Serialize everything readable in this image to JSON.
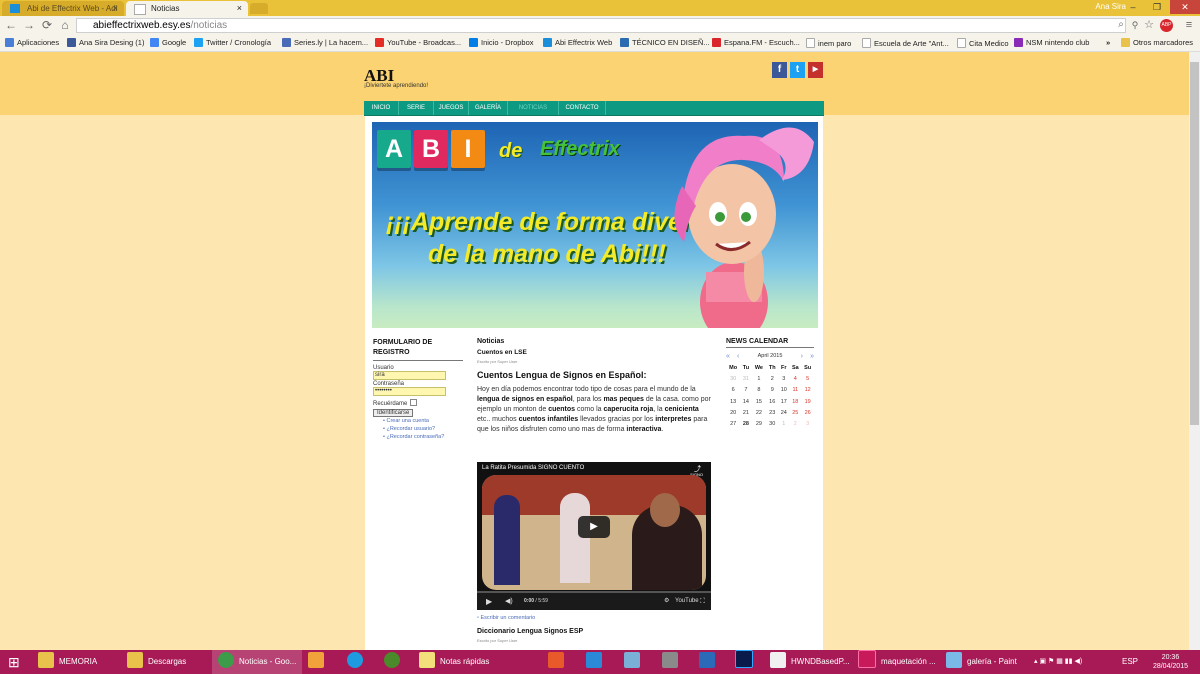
{
  "browser": {
    "tabs": [
      {
        "title": "Abi de Effectrix Web - Adi",
        "close": "×"
      },
      {
        "title": "Noticias",
        "close": "×"
      }
    ],
    "user": "Ana Sira",
    "window_controls": {
      "minimize": "–",
      "maximize": "❐",
      "close": "✕"
    },
    "nav": {
      "back": "←",
      "forward": "→",
      "reload": "⟳",
      "home": "⌂"
    },
    "url": {
      "domain": "abieffectrixweb.esy.es",
      "path": "/noticias"
    },
    "bookmarks": [
      {
        "label": "Aplicaciones",
        "color": "#4a7fd8"
      },
      {
        "label": "Ana Sira Desing (1)",
        "color": "#3b5998"
      },
      {
        "label": "Google",
        "color": "#4285f4"
      },
      {
        "label": "Twitter / Cronología",
        "color": "#1da1f2"
      },
      {
        "label": "Series.ly | La hacem...",
        "color": "#4a6bb8"
      },
      {
        "label": "YouTube - Broadcas...",
        "color": "#e52d27"
      },
      {
        "label": "Inicio - Dropbox",
        "color": "#007ee5"
      },
      {
        "label": "Abi Effectrix Web",
        "color": "#1a8ed8"
      },
      {
        "label": "TÉCNICO EN DISEÑ...",
        "color": "#2b6cb0"
      },
      {
        "label": "Espana.FM - Escuch...",
        "color": "#d8262c"
      },
      {
        "label": "inem paro",
        "color": "#cccccc"
      },
      {
        "label": "Escuela de Arte \"Ant...",
        "color": "#cccccc"
      },
      {
        "label": "Cita Medico",
        "color": "#cccccc"
      },
      {
        "label": "NSM nintendo club",
        "color": "#8a2bb8"
      }
    ],
    "bookmarks_more": "»",
    "other_bookmarks": "Otros marcadores"
  },
  "site": {
    "logo": "ABI",
    "tagline": "¡Diviertete aprendiendo!",
    "social": [
      {
        "name": "facebook",
        "glyph": "f",
        "color": "#3b5998"
      },
      {
        "name": "twitter",
        "glyph": "t",
        "color": "#1da1f2"
      },
      {
        "name": "youtube",
        "glyph": "▶",
        "color": "#c4302b"
      }
    ],
    "nav": [
      "INICIO",
      "SERIE",
      "JUEGOS",
      "GALERÍA",
      "NOTICIAS",
      "CONTACTO"
    ],
    "banner": {
      "letters": [
        "A",
        "B",
        "I"
      ],
      "letter_colors": [
        "#17a98c",
        "#e0295f",
        "#f28a14"
      ],
      "de": "de",
      "brand": "Effectrix",
      "line1": "¡¡¡Aprende de forma divertida",
      "line2": "de la mano de Abi!!!"
    }
  },
  "login": {
    "title": "FORMULARIO DE REGISTRO",
    "user_label": "Usuario",
    "user_value": "sira",
    "pass_label": "Contraseña",
    "pass_value": "••••••••",
    "remember": "Recuérdame",
    "button": "Identificarse",
    "links": [
      "Crear una cuenta",
      "¿Recordar usuario?",
      "¿Recordar contraseña?"
    ]
  },
  "article": {
    "section": "Noticias",
    "subtitle": "Cuentos en LSE",
    "meta": "Escrito por Super User",
    "title": "Cuentos Lengua de Signos en Español:",
    "body": [
      {
        "t": "Hoy en día podemos encontrar todo tipo de cosas para el mundo de la ",
        "b": false
      },
      {
        "t": "lengua de signos en español",
        "b": true
      },
      {
        "t": ", para los ",
        "b": false
      },
      {
        "t": "mas peques",
        "b": true
      },
      {
        "t": " de la casa. como por ejemplo un monton de ",
        "b": false
      },
      {
        "t": "cuentos",
        "b": true
      },
      {
        "t": " como la ",
        "b": false
      },
      {
        "t": "caperucita roja",
        "b": true
      },
      {
        "t": ", la ",
        "b": false
      },
      {
        "t": "cenicienta",
        "b": true
      },
      {
        "t": " etc.. muchos ",
        "b": false
      },
      {
        "t": "cuentos infantiles",
        "b": true
      },
      {
        "t": " llevados gracias por los ",
        "b": false
      },
      {
        "t": "interpretes",
        "b": true
      },
      {
        "t": " para que los niños disfruten como uno mas de forma ",
        "b": false
      },
      {
        "t": "interactiva",
        "b": true
      },
      {
        "t": ".",
        "b": false
      }
    ],
    "video": {
      "title": "La Ratita Presumida SIGNO CUENTO",
      "time": "0:00",
      "duration": "5:59",
      "brand": "YouTube",
      "channel": "SIGNO",
      "progress": 0.0
    },
    "comment": "Escribir un comentario",
    "next_title": "Diccionario Lengua Signos ESP",
    "next_meta": "Escrito por Super User"
  },
  "calendar": {
    "title": "NEWS CALENDAR",
    "month": "April 2015",
    "prev_year": "«",
    "prev": "‹",
    "next": "›",
    "next_year": "»",
    "days": [
      "Mo",
      "Tu",
      "We",
      "Th",
      "Fr",
      "Sa",
      "Su"
    ],
    "weeks": [
      [
        "30",
        "31",
        "1",
        "2",
        "3",
        "4",
        "5"
      ],
      [
        "6",
        "7",
        "8",
        "9",
        "10",
        "11",
        "12"
      ],
      [
        "13",
        "14",
        "15",
        "16",
        "17",
        "18",
        "19"
      ],
      [
        "20",
        "21",
        "22",
        "23",
        "24",
        "25",
        "26"
      ],
      [
        "27",
        "28",
        "29",
        "30",
        "1",
        "2",
        "3"
      ]
    ]
  },
  "taskbar": {
    "items": [
      {
        "label": "MEMORIA",
        "color": "#e8c24a"
      },
      {
        "label": "Descargas",
        "color": "#e8c24a"
      },
      {
        "label": "Noticias - Goo...",
        "color": "#3c9c4a"
      },
      {
        "label": "",
        "color": "#f2a23a"
      },
      {
        "label": "",
        "color": "#1e9be0"
      },
      {
        "label": "",
        "color": "#4a8a2a"
      },
      {
        "label": "Notas rápidas",
        "color": "#f4e07a"
      },
      {
        "label": "",
        "color": "#e85a2a"
      },
      {
        "label": "",
        "color": "#2a8ad8"
      },
      {
        "label": "",
        "color": "#7ab0d8"
      },
      {
        "label": "",
        "color": "#8a8a8a"
      },
      {
        "label": "",
        "color": "#2a6ab8"
      },
      {
        "label": "",
        "color": "#0a1a4a"
      },
      {
        "label": "HWNDBasedP...",
        "color": "#f0f0f0"
      },
      {
        "label": "maquetación ...",
        "color": "#c81a5a"
      },
      {
        "label": "galería - Paint",
        "color": "#7ab8e8"
      }
    ],
    "lang": "ESP",
    "time": "20:36",
    "date": "28/04/2015"
  }
}
